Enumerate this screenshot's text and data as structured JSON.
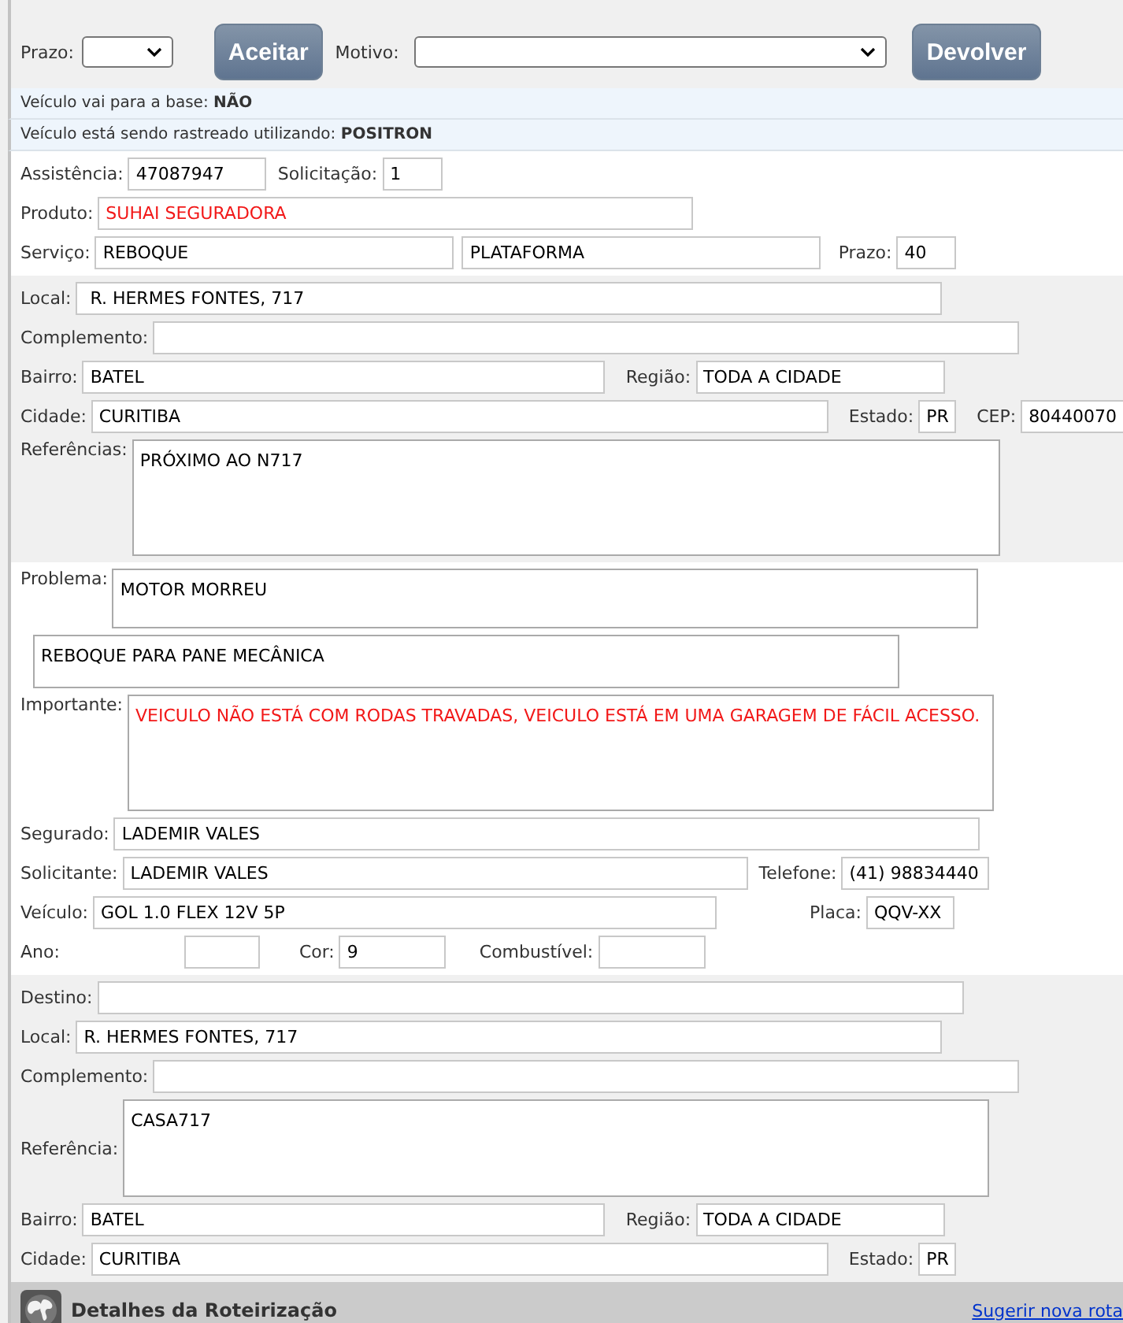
{
  "action_bar": {
    "prazo_label": "Prazo:",
    "accept_button": "Aceitar",
    "motivo_label": "Motivo:",
    "return_button": "Devolver"
  },
  "notices": [
    {
      "text": "Veículo vai para a base: **NÃO**"
    },
    {
      "text": "Veículo está sendo rastreado utilizando: **POSITRON**"
    }
  ],
  "service": {
    "assistencia": {
      "label": "Assistência:",
      "value": "47087947"
    },
    "solicitacao": {
      "label": "Solicitação:",
      "value": "1"
    },
    "produto": {
      "label": "Produto:",
      "value": "SUHAI SEGURADORA"
    },
    "servico": {
      "label": "Serviço:",
      "value": "REBOQUE",
      "value_2": "PLATAFORMA"
    },
    "prazo": {
      "label": "Prazo:",
      "value": "40"
    }
  },
  "origin": {
    "local": {
      "label": "Local:",
      "value": "R. HERMES FONTES, 717"
    },
    "complemento": {
      "label": "Complemento:"
    },
    "bairro": {
      "label": "Bairro:",
      "value": "BATEL"
    },
    "regiao": {
      "label": "Região:",
      "value": "TODA A CIDADE"
    },
    "cidade": {
      "label": "Cidade:",
      "value": "CURITIBA"
    },
    "estado": {
      "label": "Estado:",
      "value": "PR"
    },
    "cep": {
      "label": "CEP:",
      "value": "80440070"
    },
    "referencias": {
      "label": "Referências:",
      "value": "PRÓXIMO AO N717"
    }
  },
  "problem": {
    "problema": {
      "label": "Problema:",
      "value": "MOTOR MORREU"
    },
    "descricao": {
      "value": "REBOQUE PARA PANE MECÂNICA"
    },
    "importante": {
      "label": "Importante:",
      "value": "VEICULO NÃO ESTÁ COM RODAS TRAVADAS,  VEICULO ESTÁ EM UMA GARAGEM DE FÁCIL ACESSO."
    },
    "segurado": {
      "label": "Segurado:",
      "value": "LADEMIR VALES"
    },
    "solicitante": {
      "label": "Solicitante:",
      "value": "LADEMIR VALES"
    },
    "telefone": {
      "label": "Telefone:",
      "value": "(41) 98834440"
    },
    "veiculo": {
      "label": "Veículo:",
      "value": "GOL 1.0 FLEX 12V 5P"
    },
    "placa": {
      "label": "Placa:",
      "value": "QQV-XX"
    },
    "ano": {
      "label": "Ano:"
    },
    "cor": {
      "label": "Cor:",
      "value": "9"
    },
    "combustivel": {
      "label": "Combustível:"
    }
  },
  "destination": {
    "destino": {
      "label": "Destino:"
    },
    "local": {
      "label": "Local:",
      "value": "R. HERMES FONTES, 717"
    },
    "complemento": {
      "label": "Complemento:"
    },
    "referencia": {
      "label": "Referência:",
      "value": "CASA717"
    },
    "bairro": {
      "label": "Bairro:",
      "value": "BATEL"
    },
    "regiao": {
      "label": "Região:",
      "value": "TODA A CIDADE"
    },
    "cidade": {
      "label": "Cidade:",
      "value": "CURITIBA"
    },
    "estado": {
      "label": "Estado:",
      "value": "PR"
    }
  },
  "routing_bar": {
    "title": "Detalhes da Roteirização",
    "link": "Sugerir nova rota"
  }
}
